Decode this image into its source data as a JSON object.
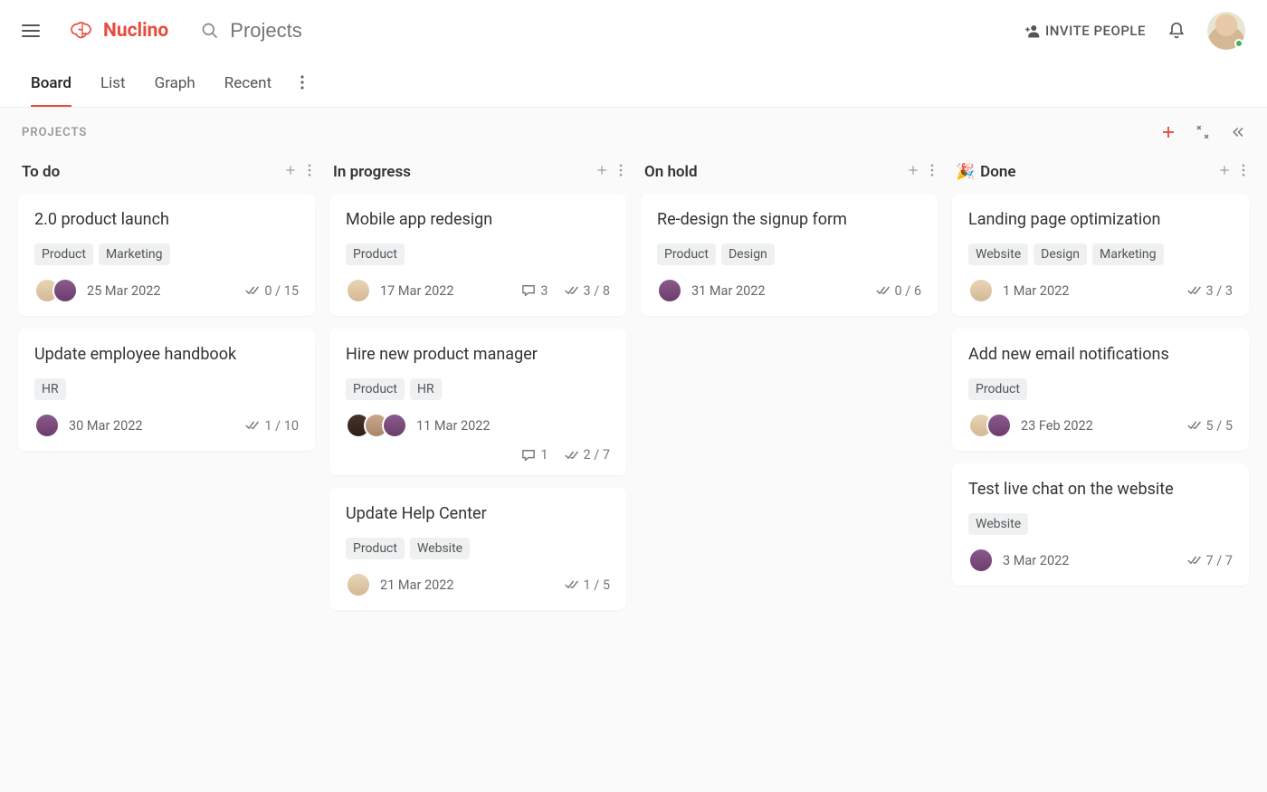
{
  "app": {
    "name": "Nuclino",
    "search_placeholder": "Projects",
    "invite_label": "INVITE PEOPLE"
  },
  "tabs": [
    {
      "label": "Board",
      "active": true
    },
    {
      "label": "List",
      "active": false
    },
    {
      "label": "Graph",
      "active": false
    },
    {
      "label": "Recent",
      "active": false
    }
  ],
  "board": {
    "title": "PROJECTS",
    "columns": [
      {
        "title": "To do",
        "emoji": "",
        "cards": [
          {
            "title": "2.0 product launch",
            "tags": [
              "Product",
              "Marketing"
            ],
            "avatars": [
              "c1",
              "c2"
            ],
            "date": "25 Mar 2022",
            "comments": null,
            "tasks": "0 / 15"
          },
          {
            "title": "Update employee handbook",
            "tags": [
              "HR"
            ],
            "avatars": [
              "c2"
            ],
            "date": "30 Mar 2022",
            "comments": null,
            "tasks": "1 / 10"
          }
        ]
      },
      {
        "title": "In progress",
        "emoji": "",
        "cards": [
          {
            "title": "Mobile app redesign",
            "tags": [
              "Product"
            ],
            "avatars": [
              "c1"
            ],
            "date": "17 Mar 2022",
            "comments": "3",
            "tasks": "3 / 8"
          },
          {
            "title": "Hire new product manager",
            "tags": [
              "Product",
              "HR"
            ],
            "avatars": [
              "c3",
              "c4",
              "c2"
            ],
            "date": "11 Mar 2022",
            "comments": "1",
            "tasks": "2 / 7",
            "wrap": true
          },
          {
            "title": "Update Help Center",
            "tags": [
              "Product",
              "Website"
            ],
            "avatars": [
              "c1"
            ],
            "date": "21 Mar 2022",
            "comments": null,
            "tasks": "1 / 5"
          }
        ]
      },
      {
        "title": "On hold",
        "emoji": "",
        "cards": [
          {
            "title": "Re-design the signup form",
            "tags": [
              "Product",
              "Design"
            ],
            "avatars": [
              "c2"
            ],
            "date": "31 Mar 2022",
            "comments": null,
            "tasks": "0 / 6"
          }
        ]
      },
      {
        "title": "Done",
        "emoji": "🎉",
        "cards": [
          {
            "title": "Landing page optimization",
            "tags": [
              "Website",
              "Design",
              "Marketing"
            ],
            "avatars": [
              "c1"
            ],
            "date": "1 Mar 2022",
            "comments": null,
            "tasks": "3 / 3"
          },
          {
            "title": "Add new email notifications",
            "tags": [
              "Product"
            ],
            "avatars": [
              "c1",
              "c2"
            ],
            "date": "23 Feb 2022",
            "comments": null,
            "tasks": "5 / 5"
          },
          {
            "title": "Test live chat on the website",
            "tags": [
              "Website"
            ],
            "avatars": [
              "c2"
            ],
            "date": "3 Mar 2022",
            "comments": null,
            "tasks": "7 / 7"
          }
        ]
      }
    ]
  }
}
